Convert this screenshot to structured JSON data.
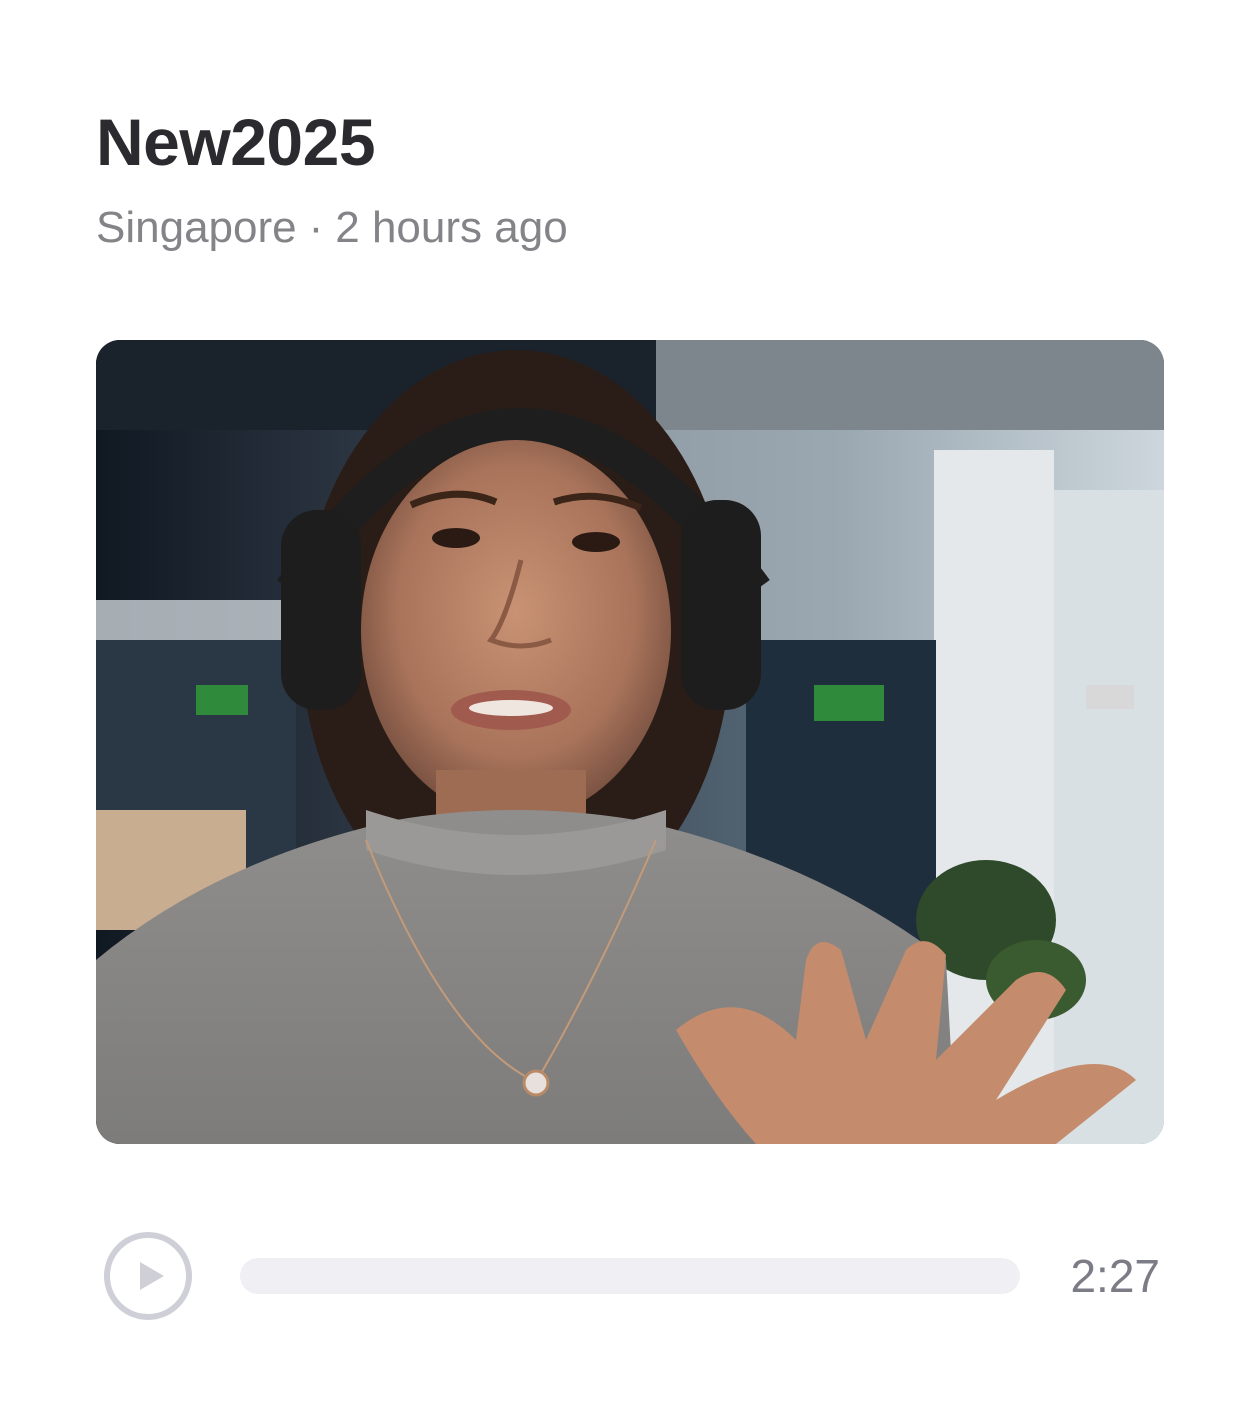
{
  "post": {
    "title": "New2025",
    "location": "Singapore",
    "separator": "·",
    "time_ago": "2 hours ago"
  },
  "media": {
    "thumbnail_description": "video-thumbnail"
  },
  "player": {
    "duration": "2:27",
    "progress": 0,
    "play_icon": "play-icon"
  },
  "colors": {
    "title": "#2b2b2f",
    "meta": "#838388",
    "track": "#efeff4",
    "play_ring": "#cfcfd8"
  }
}
